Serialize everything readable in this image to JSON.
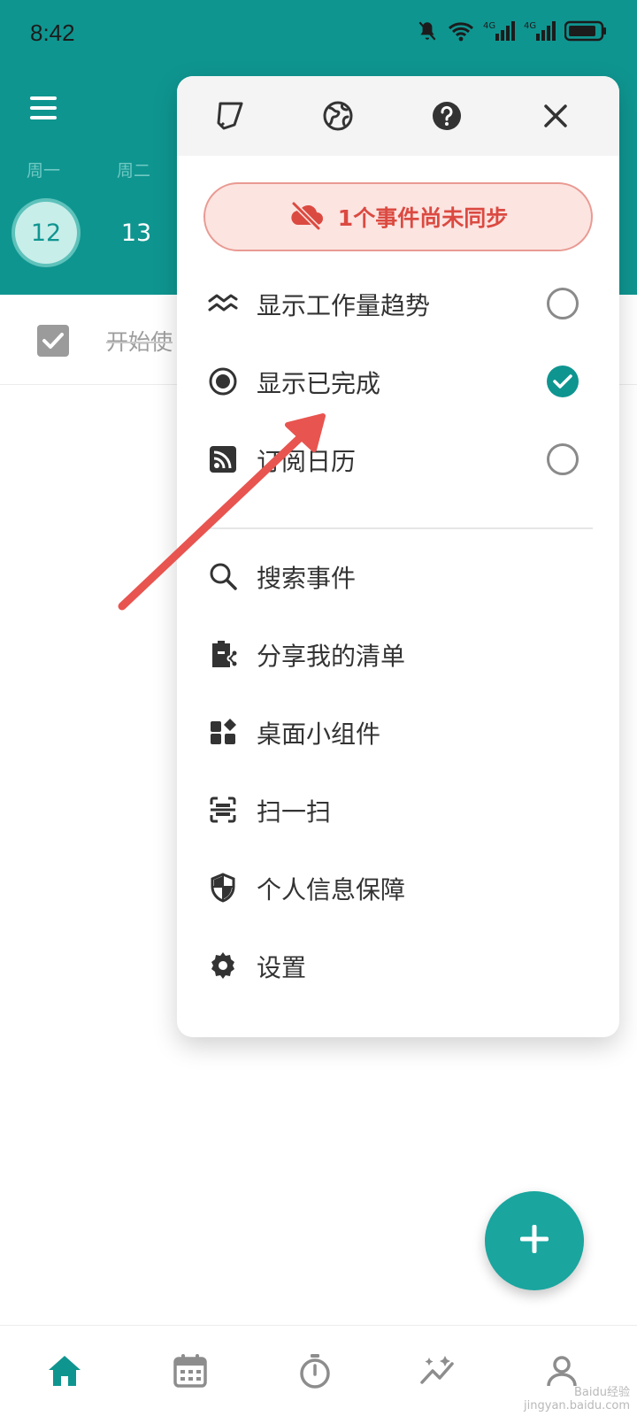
{
  "status_bar": {
    "time": "8:42",
    "icons": [
      "bell-off-icon",
      "wifi-icon",
      "signal-4g-icon",
      "signal-4g-icon",
      "battery-icon"
    ],
    "network_label_1": "4G",
    "network_label_2": "4G"
  },
  "header": {
    "menu_icon": "hamburger-icon",
    "weekdays": [
      "周一",
      "周二"
    ],
    "days": [
      "12",
      "13"
    ],
    "selected_day": "12"
  },
  "task_list": {
    "items": [
      {
        "title": "开始使",
        "completed": true
      }
    ]
  },
  "popup": {
    "header_icons": [
      "theme-icon",
      "globe-icon",
      "help-icon",
      "close-icon"
    ],
    "sync_banner": "1个事件尚未同步",
    "toggles": [
      {
        "label": "显示工作量趋势",
        "icon": "trend-icon",
        "checked": false
      },
      {
        "label": "显示已完成",
        "icon": "radio-dot-icon",
        "checked": true
      },
      {
        "label": "订阅日历",
        "icon": "rss-icon",
        "checked": false
      }
    ],
    "actions": [
      {
        "label": "搜索事件",
        "icon": "search-icon"
      },
      {
        "label": "分享我的清单",
        "icon": "share-list-icon"
      },
      {
        "label": "桌面小组件",
        "icon": "widgets-icon"
      },
      {
        "label": "扫一扫",
        "icon": "scan-icon"
      },
      {
        "label": "个人信息保障",
        "icon": "shield-icon"
      },
      {
        "label": "设置",
        "icon": "settings-gear-icon"
      }
    ]
  },
  "fab": {
    "icon": "plus-icon"
  },
  "bottom_nav": {
    "items": [
      "home-icon",
      "calendar-icon",
      "timer-icon",
      "stats-icon",
      "profile-icon"
    ],
    "active": "home-icon"
  },
  "colors": {
    "primary": "#0f9590",
    "fab": "#1aa59f",
    "sync_text": "#db4a41",
    "sync_bg": "#fce4e1",
    "arrow": "#e8544f"
  },
  "watermark": {
    "line1": "Baidu经验",
    "line2": "jingyan.baidu.com"
  }
}
